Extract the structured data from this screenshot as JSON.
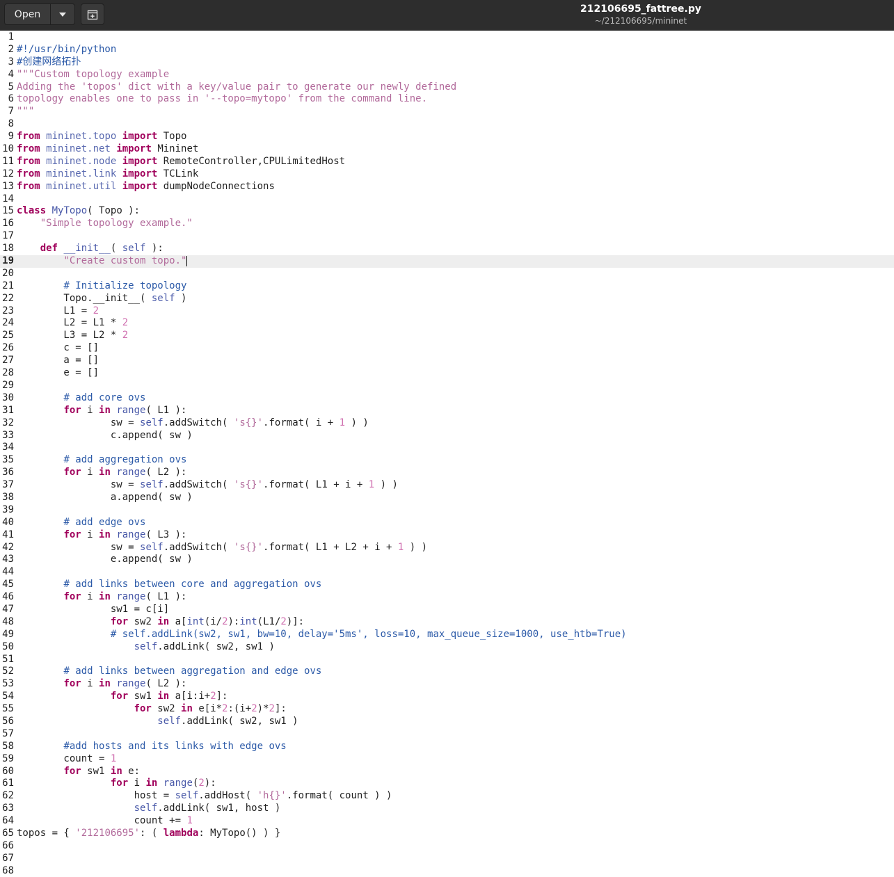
{
  "header": {
    "open_label": "Open",
    "title": "212106695_fattree.py",
    "subtitle": "~/212106695/mininet",
    "menu_icon": "chevron-down-icon",
    "new_tab_icon": "new-document-icon"
  },
  "editor": {
    "current_line": 19,
    "lines": [
      [],
      [
        [
          "#!/usr/bin/python",
          "cmt"
        ]
      ],
      [
        [
          "#创建网络拓扑",
          "cmt"
        ]
      ],
      [
        [
          "\"\"\"Custom topology example",
          "str"
        ]
      ],
      [
        [
          "Adding the 'topos' dict with a key/value pair to generate our newly defined",
          "str"
        ]
      ],
      [
        [
          "topology enables one to pass in '--topo=mytopo' from the command line.",
          "str"
        ]
      ],
      [
        [
          "\"\"\"",
          "str"
        ]
      ],
      [],
      [
        [
          "from",
          "kw"
        ],
        [
          " ",
          "pl"
        ],
        [
          "mininet.topo",
          "mod"
        ],
        [
          " ",
          "pl"
        ],
        [
          "import",
          "kw"
        ],
        [
          " Topo",
          "pl"
        ]
      ],
      [
        [
          "from",
          "kw"
        ],
        [
          " ",
          "pl"
        ],
        [
          "mininet.net",
          "mod"
        ],
        [
          " ",
          "pl"
        ],
        [
          "import",
          "kw"
        ],
        [
          " Mininet",
          "pl"
        ]
      ],
      [
        [
          "from",
          "kw"
        ],
        [
          " ",
          "pl"
        ],
        [
          "mininet.node",
          "mod"
        ],
        [
          " ",
          "pl"
        ],
        [
          "import",
          "kw"
        ],
        [
          " RemoteController,CPULimitedHost",
          "pl"
        ]
      ],
      [
        [
          "from",
          "kw"
        ],
        [
          " ",
          "pl"
        ],
        [
          "mininet.link",
          "mod"
        ],
        [
          " ",
          "pl"
        ],
        [
          "import",
          "kw"
        ],
        [
          " TCLink",
          "pl"
        ]
      ],
      [
        [
          "from",
          "kw"
        ],
        [
          " ",
          "pl"
        ],
        [
          "mininet.util",
          "mod"
        ],
        [
          " ",
          "pl"
        ],
        [
          "import",
          "kw"
        ],
        [
          " dumpNodeConnections",
          "pl"
        ]
      ],
      [],
      [
        [
          "class",
          "kw"
        ],
        [
          " ",
          "pl"
        ],
        [
          "MyTopo",
          "cls"
        ],
        [
          "( Topo ):",
          "pl"
        ]
      ],
      [
        [
          "    ",
          "pl"
        ],
        [
          "\"Simple topology example.\"",
          "str"
        ]
      ],
      [],
      [
        [
          "    ",
          "pl"
        ],
        [
          "def",
          "kw"
        ],
        [
          " ",
          "pl"
        ],
        [
          "__init__",
          "bi"
        ],
        [
          "( ",
          "pl"
        ],
        [
          "self",
          "bi"
        ],
        [
          " ):",
          "pl"
        ]
      ],
      [
        [
          "        ",
          "pl"
        ],
        [
          "\"Create custom topo.\"",
          "str"
        ]
      ],
      [],
      [
        [
          "        ",
          "pl"
        ],
        [
          "# Initialize topology",
          "cmt"
        ]
      ],
      [
        [
          "        Topo.__init__( ",
          "pl"
        ],
        [
          "self",
          "bi"
        ],
        [
          " )",
          "pl"
        ]
      ],
      [
        [
          "        L1 = ",
          "pl"
        ],
        [
          "2",
          "num"
        ]
      ],
      [
        [
          "        L2 = L1 * ",
          "pl"
        ],
        [
          "2",
          "num"
        ]
      ],
      [
        [
          "        L3 = L2 * ",
          "pl"
        ],
        [
          "2",
          "num"
        ]
      ],
      [
        [
          "        c = []",
          "pl"
        ]
      ],
      [
        [
          "        a = []",
          "pl"
        ]
      ],
      [
        [
          "        e = []",
          "pl"
        ]
      ],
      [],
      [
        [
          "        ",
          "pl"
        ],
        [
          "# add core ovs",
          "cmt"
        ]
      ],
      [
        [
          "        ",
          "pl"
        ],
        [
          "for",
          "kw"
        ],
        [
          " i ",
          "pl"
        ],
        [
          "in",
          "kw"
        ],
        [
          " ",
          "pl"
        ],
        [
          "range",
          "bi"
        ],
        [
          "( L1 ):",
          "pl"
        ]
      ],
      [
        [
          "                sw = ",
          "pl"
        ],
        [
          "self",
          "bi"
        ],
        [
          ".addSwitch( ",
          "pl"
        ],
        [
          "'s{}'",
          "str"
        ],
        [
          ".format( i + ",
          "pl"
        ],
        [
          "1",
          "num"
        ],
        [
          " ) )",
          "pl"
        ]
      ],
      [
        [
          "                c.append( sw )",
          "pl"
        ]
      ],
      [],
      [
        [
          "        ",
          "pl"
        ],
        [
          "# add aggregation ovs",
          "cmt"
        ]
      ],
      [
        [
          "        ",
          "pl"
        ],
        [
          "for",
          "kw"
        ],
        [
          " i ",
          "pl"
        ],
        [
          "in",
          "kw"
        ],
        [
          " ",
          "pl"
        ],
        [
          "range",
          "bi"
        ],
        [
          "( L2 ):",
          "pl"
        ]
      ],
      [
        [
          "                sw = ",
          "pl"
        ],
        [
          "self",
          "bi"
        ],
        [
          ".addSwitch( ",
          "pl"
        ],
        [
          "'s{}'",
          "str"
        ],
        [
          ".format( L1 + i + ",
          "pl"
        ],
        [
          "1",
          "num"
        ],
        [
          " ) )",
          "pl"
        ]
      ],
      [
        [
          "                a.append( sw )",
          "pl"
        ]
      ],
      [],
      [
        [
          "        ",
          "pl"
        ],
        [
          "# add edge ovs",
          "cmt"
        ]
      ],
      [
        [
          "        ",
          "pl"
        ],
        [
          "for",
          "kw"
        ],
        [
          " i ",
          "pl"
        ],
        [
          "in",
          "kw"
        ],
        [
          " ",
          "pl"
        ],
        [
          "range",
          "bi"
        ],
        [
          "( L3 ):",
          "pl"
        ]
      ],
      [
        [
          "                sw = ",
          "pl"
        ],
        [
          "self",
          "bi"
        ],
        [
          ".addSwitch( ",
          "pl"
        ],
        [
          "'s{}'",
          "str"
        ],
        [
          ".format( L1 + L2 + i + ",
          "pl"
        ],
        [
          "1",
          "num"
        ],
        [
          " ) )",
          "pl"
        ]
      ],
      [
        [
          "                e.append( sw )",
          "pl"
        ]
      ],
      [],
      [
        [
          "        ",
          "pl"
        ],
        [
          "# add links between core and aggregation ovs",
          "cmt"
        ]
      ],
      [
        [
          "        ",
          "pl"
        ],
        [
          "for",
          "kw"
        ],
        [
          " i ",
          "pl"
        ],
        [
          "in",
          "kw"
        ],
        [
          " ",
          "pl"
        ],
        [
          "range",
          "bi"
        ],
        [
          "( L1 ):",
          "pl"
        ]
      ],
      [
        [
          "                sw1 = c[i]",
          "pl"
        ]
      ],
      [
        [
          "                ",
          "pl"
        ],
        [
          "for",
          "kw"
        ],
        [
          " sw2 ",
          "pl"
        ],
        [
          "in",
          "kw"
        ],
        [
          " a[",
          "pl"
        ],
        [
          "int",
          "bi"
        ],
        [
          "(i/",
          "pl"
        ],
        [
          "2",
          "num"
        ],
        [
          "):",
          "pl"
        ],
        [
          "int",
          "bi"
        ],
        [
          "(L1/",
          "pl"
        ],
        [
          "2",
          "num"
        ],
        [
          ")]:",
          "pl"
        ]
      ],
      [
        [
          "                ",
          "pl"
        ],
        [
          "# self.addLink(sw2, sw1, bw=10, delay='5ms', loss=10, max_queue_size=1000, use_htb=True)",
          "cmt"
        ]
      ],
      [
        [
          "                    ",
          "pl"
        ],
        [
          "self",
          "bi"
        ],
        [
          ".addLink( sw2, sw1 )",
          "pl"
        ]
      ],
      [],
      [
        [
          "        ",
          "pl"
        ],
        [
          "# add links between aggregation and edge ovs",
          "cmt"
        ]
      ],
      [
        [
          "        ",
          "pl"
        ],
        [
          "for",
          "kw"
        ],
        [
          " i ",
          "pl"
        ],
        [
          "in",
          "kw"
        ],
        [
          " ",
          "pl"
        ],
        [
          "range",
          "bi"
        ],
        [
          "( L2 ):",
          "pl"
        ]
      ],
      [
        [
          "                ",
          "pl"
        ],
        [
          "for",
          "kw"
        ],
        [
          " sw1 ",
          "pl"
        ],
        [
          "in",
          "kw"
        ],
        [
          " a[i:i+",
          "pl"
        ],
        [
          "2",
          "num"
        ],
        [
          "]:",
          "pl"
        ]
      ],
      [
        [
          "                    ",
          "pl"
        ],
        [
          "for",
          "kw"
        ],
        [
          " sw2 ",
          "pl"
        ],
        [
          "in",
          "kw"
        ],
        [
          " e[i*",
          "pl"
        ],
        [
          "2",
          "num"
        ],
        [
          ":(i+",
          "pl"
        ],
        [
          "2",
          "num"
        ],
        [
          ")*",
          "pl"
        ],
        [
          "2",
          "num"
        ],
        [
          "]:",
          "pl"
        ]
      ],
      [
        [
          "                        ",
          "pl"
        ],
        [
          "self",
          "bi"
        ],
        [
          ".addLink( sw2, sw1 )",
          "pl"
        ]
      ],
      [],
      [
        [
          "        ",
          "pl"
        ],
        [
          "#add hosts and its links with edge ovs",
          "cmt"
        ]
      ],
      [
        [
          "        count = ",
          "pl"
        ],
        [
          "1",
          "num"
        ]
      ],
      [
        [
          "        ",
          "pl"
        ],
        [
          "for",
          "kw"
        ],
        [
          " sw1 ",
          "pl"
        ],
        [
          "in",
          "kw"
        ],
        [
          " e:",
          "pl"
        ]
      ],
      [
        [
          "                ",
          "pl"
        ],
        [
          "for",
          "kw"
        ],
        [
          " i ",
          "pl"
        ],
        [
          "in",
          "kw"
        ],
        [
          " ",
          "pl"
        ],
        [
          "range",
          "bi"
        ],
        [
          "(",
          "pl"
        ],
        [
          "2",
          "num"
        ],
        [
          "):",
          "pl"
        ]
      ],
      [
        [
          "                    host = ",
          "pl"
        ],
        [
          "self",
          "bi"
        ],
        [
          ".addHost( ",
          "pl"
        ],
        [
          "'h{}'",
          "str"
        ],
        [
          ".format( count ) )",
          "pl"
        ]
      ],
      [
        [
          "                    ",
          "pl"
        ],
        [
          "self",
          "bi"
        ],
        [
          ".addLink( sw1, host )",
          "pl"
        ]
      ],
      [
        [
          "                    count += ",
          "pl"
        ],
        [
          "1",
          "num"
        ]
      ],
      [
        [
          "topos = { ",
          "pl"
        ],
        [
          "'212106695'",
          "str"
        ],
        [
          ": ( ",
          "pl"
        ],
        [
          "lambda",
          "kw"
        ],
        [
          ": MyTopo() ) }",
          "pl"
        ]
      ],
      [],
      [],
      []
    ]
  }
}
